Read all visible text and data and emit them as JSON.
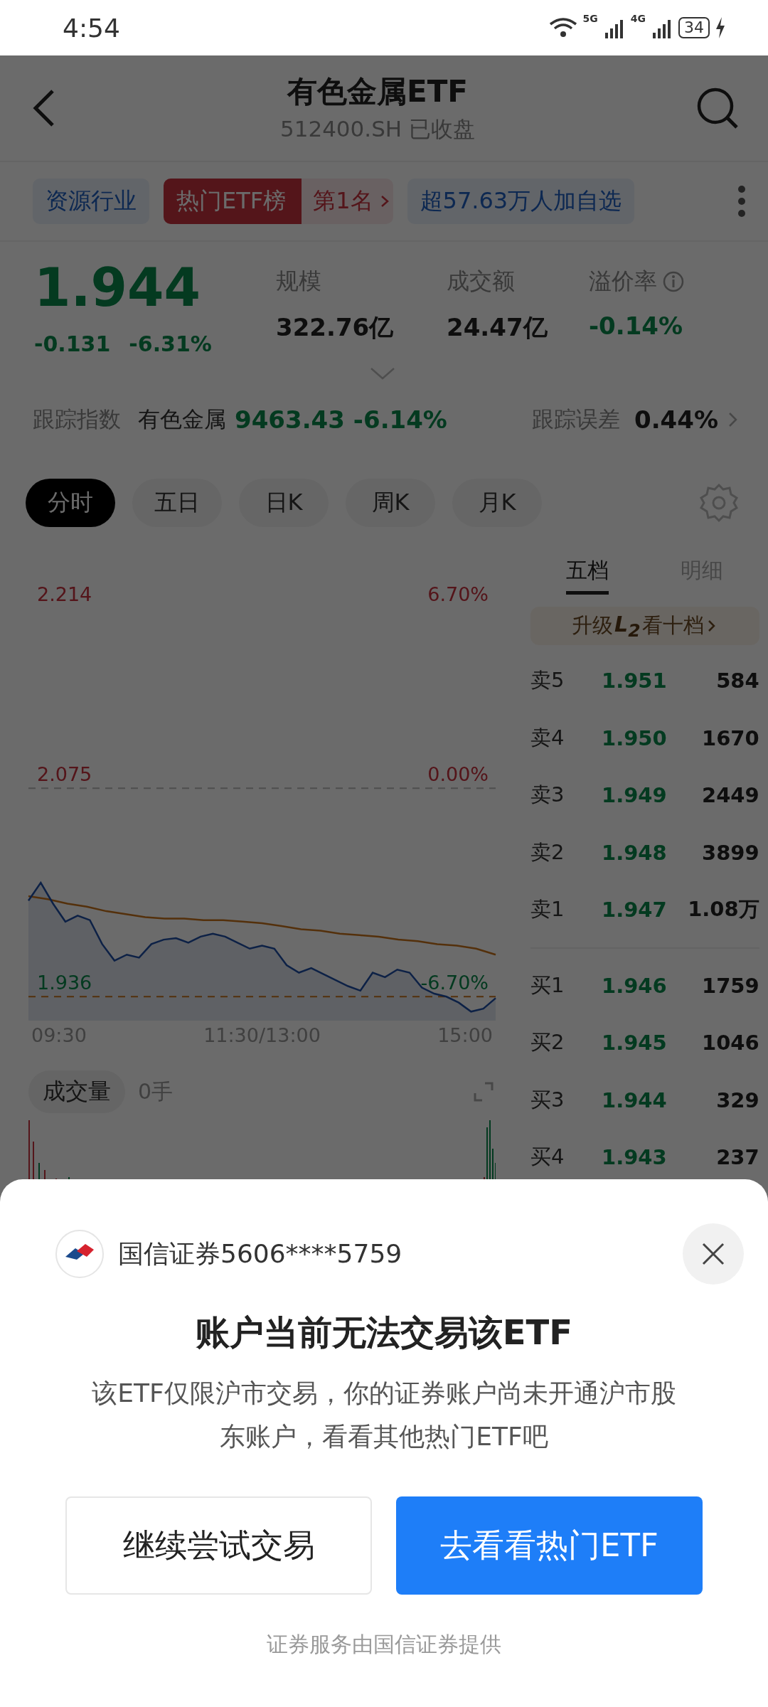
{
  "status_bar": {
    "time": "4:54",
    "networks": [
      "5G",
      "4G"
    ],
    "battery": "34"
  },
  "header": {
    "title": "有色金属ETF",
    "subtitle": "512400.SH 已收盘"
  },
  "tag_row": {
    "industry": "资源行业",
    "rank_label": "热门ETF榜",
    "rank": "第1名",
    "followers": "超57.63万人加自选"
  },
  "quote": {
    "price": "1.944",
    "change": "-0.131",
    "change_pct": "-6.31%",
    "stats": [
      {
        "label": "规模",
        "value": "322.76亿",
        "kind": "amount"
      },
      {
        "label": "成交额",
        "value": "24.47亿",
        "kind": "amount"
      },
      {
        "label": "溢价率",
        "value": "-0.14%",
        "kind": "premium"
      }
    ]
  },
  "tracking": {
    "label": "跟踪指数",
    "index_name": "有色金属",
    "index_value": "9463.43",
    "index_change": "-6.14%",
    "error_label": "跟踪误差",
    "error_value": "0.44%"
  },
  "periods": [
    {
      "label": "分时",
      "selected": true
    },
    {
      "label": "五日",
      "selected": false
    },
    {
      "label": "日K",
      "selected": false
    },
    {
      "label": "周K",
      "selected": false
    },
    {
      "label": "月K",
      "selected": false
    }
  ],
  "chart": {
    "price_labels": [
      "2.214",
      "2.075",
      "1.936"
    ],
    "pct_labels": [
      "6.70%",
      "0.00%",
      "-6.70%"
    ],
    "time_labels": [
      "09:30",
      "11:30/13:00",
      "15:00"
    ]
  },
  "volume": {
    "label": "成交量",
    "value": "0手"
  },
  "order_book": {
    "tabs": [
      {
        "label": "五档",
        "selected": true
      },
      {
        "label": "明细",
        "selected": false
      }
    ],
    "upgrade": {
      "prefix": "升级",
      "badge": "L$_{2}$",
      "suffix": "看十档"
    },
    "asks": [
      {
        "label": "卖5",
        "price": "1.951",
        "volume": "584"
      },
      {
        "label": "卖4",
        "price": "1.950",
        "volume": "1670"
      },
      {
        "label": "卖3",
        "price": "1.949",
        "volume": "2449"
      },
      {
        "label": "卖2",
        "price": "1.948",
        "volume": "3899"
      },
      {
        "label": "卖1",
        "price": "1.947",
        "volume": "1.08万"
      }
    ],
    "bids": [
      {
        "label": "买1",
        "price": "1.946",
        "volume": "1759"
      },
      {
        "label": "买2",
        "price": "1.945",
        "volume": "1046"
      },
      {
        "label": "买3",
        "price": "1.944",
        "volume": "329"
      },
      {
        "label": "买4",
        "price": "1.943",
        "volume": "237"
      }
    ]
  },
  "dialog": {
    "broker": "国信证券5606****5759",
    "title": "账户当前无法交易该ETF",
    "message": "该ETF仅限沪市交易，你的证券账户尚未开通沪市股东账户，看看其他热门ETF吧",
    "buttons": [
      {
        "label": "继续尝试交易",
        "kind": "secondary"
      },
      {
        "label": "去看看热门ETF",
        "kind": "primary"
      }
    ],
    "footer": "证券服务由国信证券提供"
  }
}
